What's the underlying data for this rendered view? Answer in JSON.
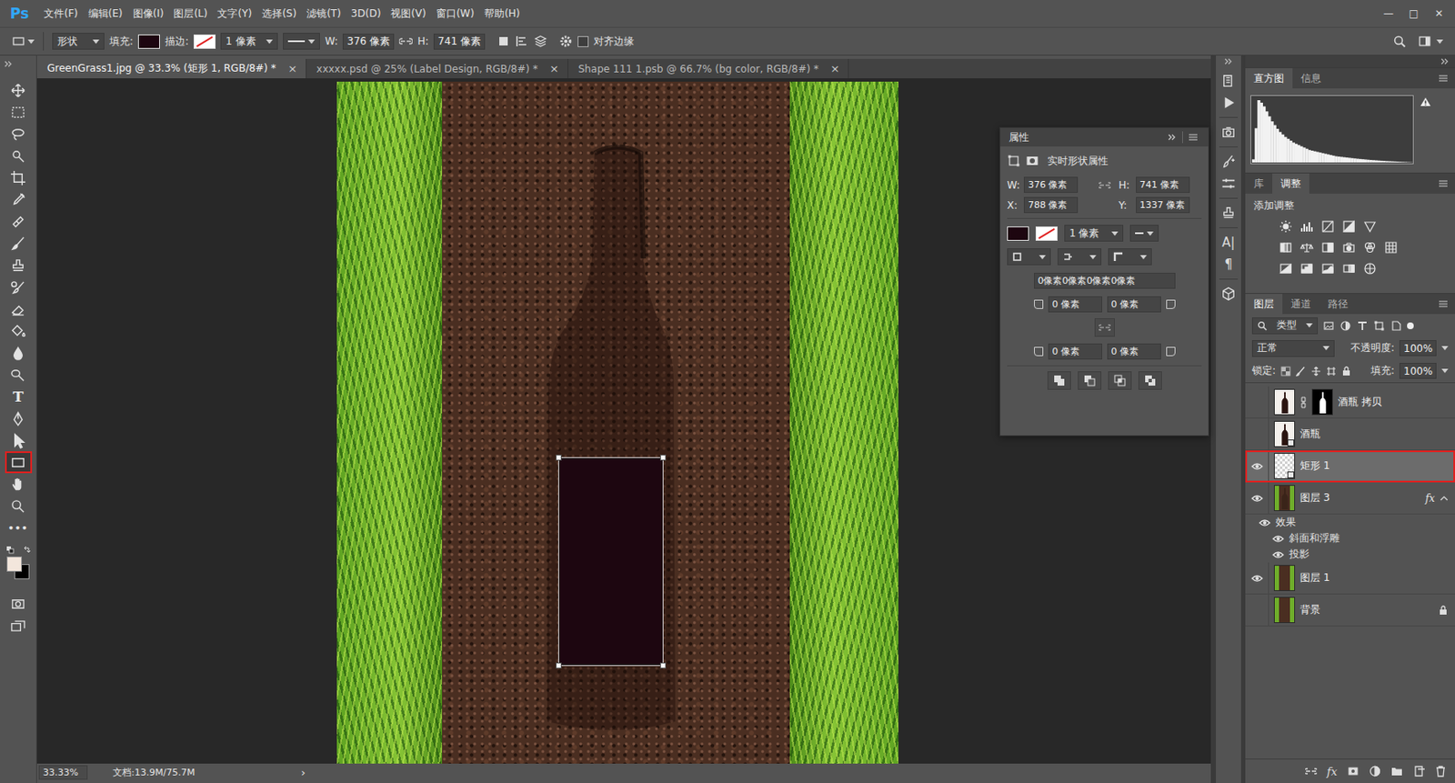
{
  "app": {
    "logo": "Ps",
    "window_controls": [
      "—",
      "□",
      "✕"
    ]
  },
  "menu": [
    "文件(F)",
    "编辑(E)",
    "图像(I)",
    "图层(L)",
    "文字(Y)",
    "选择(S)",
    "滤镜(T)",
    "3D(D)",
    "视图(V)",
    "窗口(W)",
    "帮助(H)"
  ],
  "options_bar": {
    "mode": "形状",
    "fill_label": "填充:",
    "fill_color": "#1d0610",
    "stroke_label": "描边:",
    "stroke_width": "1 像素",
    "w_label": "W:",
    "w_value": "376 像素",
    "h_label": "H:",
    "h_value": "741 像素",
    "align_edges": {
      "label": "对齐边缘",
      "checked": false
    }
  },
  "doc_tabs": [
    {
      "label": "GreenGrass1.jpg @ 33.3% (矩形 1, RGB/8#) *",
      "close": "×",
      "selected": true
    },
    {
      "label": "xxxxx.psd @ 25% (Label Design, RGB/8#) *",
      "close": "×",
      "selected": false
    },
    {
      "label": "Shape 111 1.psb @ 66.7% (bg color, RGB/8#) *",
      "close": "×",
      "selected": false
    }
  ],
  "tools": [
    {
      "kind": "move",
      "selected": false,
      "highlighted": false
    },
    {
      "kind": "marquee",
      "selected": false,
      "highlighted": false
    },
    {
      "kind": "lasso",
      "selected": false,
      "highlighted": false
    },
    {
      "kind": "quick-select",
      "selected": false,
      "highlighted": false
    },
    {
      "kind": "crop",
      "selected": false,
      "highlighted": false
    },
    {
      "kind": "eyedropper",
      "selected": false,
      "highlighted": false
    },
    {
      "kind": "healing",
      "selected": false,
      "highlighted": false
    },
    {
      "kind": "brush",
      "selected": false,
      "highlighted": false
    },
    {
      "kind": "stamp",
      "selected": false,
      "highlighted": false
    },
    {
      "kind": "history-brush",
      "selected": false,
      "highlighted": false
    },
    {
      "kind": "eraser",
      "selected": false,
      "highlighted": false
    },
    {
      "kind": "bucket",
      "selected": false,
      "highlighted": false
    },
    {
      "kind": "blur",
      "selected": false,
      "highlighted": false
    },
    {
      "kind": "dodge",
      "selected": false,
      "highlighted": false
    },
    {
      "kind": "type",
      "glyph": "T",
      "selected": false,
      "highlighted": false
    },
    {
      "kind": "pen",
      "selected": false,
      "highlighted": false
    },
    {
      "kind": "path-select",
      "selected": false,
      "highlighted": false
    },
    {
      "kind": "rectangle",
      "selected": true,
      "highlighted": true
    },
    {
      "kind": "hand",
      "selected": false,
      "highlighted": false
    },
    {
      "kind": "zoom",
      "selected": false,
      "highlighted": false
    },
    {
      "kind": "more",
      "glyph": "•••",
      "selected": false,
      "highlighted": false
    }
  ],
  "colors": {
    "foreground": "#f3e6dc",
    "background": "#000000"
  },
  "view_modes": [
    {
      "kind": "quick-mask"
    },
    {
      "kind": "screen-mode"
    }
  ],
  "canvas": {
    "shape": {
      "fill": "#1d0610",
      "selected": true
    }
  },
  "status_bar": {
    "zoom": "33.33%",
    "doc": "文档:13.9M/75.7M",
    "arrow": "›"
  },
  "dock": [
    {
      "kind": "history",
      "separator_before": false
    },
    {
      "kind": "actions",
      "separator_before": false
    },
    {
      "kind": "info",
      "separator_before": true
    },
    {
      "kind": "brush",
      "separator_before": true
    },
    {
      "kind": "sliders",
      "separator_before": false
    },
    {
      "kind": "clone-source",
      "separator_before": true
    },
    {
      "kind": "character",
      "glyph": "A|",
      "separator_before": true
    },
    {
      "kind": "paragraph",
      "glyph": "¶",
      "separator_before": false
    },
    {
      "kind": "3d",
      "separator_before": true
    }
  ],
  "properties": {
    "title": "属性",
    "subtitle": "实时形状属性",
    "fields": [
      {
        "label": "W:",
        "value": "376 像素"
      },
      {
        "label": "H:",
        "value": "741 像素"
      },
      {
        "label": "X:",
        "value": "788 像素"
      },
      {
        "label": "Y:",
        "value": "1337 像素"
      }
    ],
    "fill_color": "#1d0610",
    "stroke_width": "1 像素",
    "corners_all": "0像素0像素0像素0像素",
    "corners": [
      {
        "value": "0 像素"
      },
      {
        "value": "0 像素"
      },
      {
        "value": "0 像素"
      },
      {
        "value": "0 像素"
      }
    ],
    "path_ops": [
      {
        "kind": "combine"
      },
      {
        "kind": "subtract"
      },
      {
        "kind": "intersect"
      },
      {
        "kind": "exclude"
      }
    ]
  },
  "histogram_panel": {
    "tabs": [
      {
        "label": "直方图",
        "selected": true
      },
      {
        "label": "信息",
        "selected": false
      }
    ],
    "warning": true,
    "values": [
      0.05,
      0.55,
      1.0,
      0.96,
      0.9,
      0.82,
      0.74,
      0.66,
      0.6,
      0.54,
      0.49,
      0.45,
      0.41,
      0.38,
      0.35,
      0.32,
      0.3,
      0.28,
      0.26,
      0.24,
      0.22,
      0.2,
      0.19,
      0.18,
      0.17,
      0.16,
      0.15,
      0.14,
      0.13,
      0.12,
      0.11,
      0.1,
      0.095,
      0.09,
      0.085,
      0.08,
      0.075,
      0.07,
      0.065,
      0.06,
      0.056,
      0.052,
      0.048,
      0.044,
      0.04,
      0.037,
      0.034,
      0.031,
      0.028,
      0.025,
      0.022,
      0.02,
      0.018,
      0.016,
      0.014,
      0.012,
      0.01,
      0.008,
      0.006,
      0.004
    ]
  },
  "adjustments_panel": {
    "tabs": [
      {
        "label": "库",
        "selected": false
      },
      {
        "label": "调整",
        "selected": true
      }
    ],
    "heading": "添加调整",
    "rows": [
      [
        {
          "kind": "brightness"
        },
        {
          "kind": "levels"
        },
        {
          "kind": "curves"
        },
        {
          "kind": "exposure"
        },
        {
          "kind": "vibrance"
        }
      ],
      [
        {
          "kind": "hue-saturation"
        },
        {
          "kind": "color-balance"
        },
        {
          "kind": "black-white"
        },
        {
          "kind": "photo-filter"
        },
        {
          "kind": "channel-mixer"
        },
        {
          "kind": "color-lookup"
        }
      ],
      [
        {
          "kind": "invert"
        },
        {
          "kind": "posterize"
        },
        {
          "kind": "threshold"
        },
        {
          "kind": "gradient-map"
        },
        {
          "kind": "selective-color"
        }
      ]
    ]
  },
  "layers_panel": {
    "tabs": [
      {
        "label": "图层",
        "selected": true
      },
      {
        "label": "通道",
        "selected": false
      },
      {
        "label": "路径",
        "selected": false
      }
    ],
    "filter": "类型",
    "blend": "正常",
    "opacity_label": "不透明度:",
    "opacity": "100%",
    "lock_label": "锁定:",
    "fill_label": "填充:",
    "fill": "100%",
    "layers": [
      {
        "name": "酒瓶 拷贝",
        "thumb": "bottle",
        "mask": true,
        "badge": false,
        "visible": false,
        "selected": false,
        "highlighted": false,
        "locked": false
      },
      {
        "name": "酒瓶",
        "thumb": "bottle",
        "mask": false,
        "badge": true,
        "visible": false,
        "selected": false,
        "highlighted": false,
        "locked": false
      },
      {
        "name": "矩形 1",
        "thumb": "shape",
        "mask": false,
        "badge": true,
        "visible": true,
        "selected": true,
        "highlighted": true,
        "locked": false
      },
      {
        "name": "图层 3",
        "thumb": "grass-bottle",
        "mask": false,
        "badge": false,
        "visible": true,
        "selected": false,
        "highlighted": false,
        "locked": false,
        "fx": "fx",
        "expanded": true,
        "effects": {
          "label": "效果",
          "visible": true,
          "items": [
            {
              "label": "斜面和浮雕",
              "visible": true
            },
            {
              "label": "投影",
              "visible": true
            }
          ]
        }
      },
      {
        "name": "图层 1",
        "thumb": "grass",
        "mask": false,
        "badge": false,
        "visible": true,
        "selected": false,
        "highlighted": false,
        "locked": false
      },
      {
        "name": "背景",
        "thumb": "grass",
        "mask": false,
        "badge": false,
        "visible": false,
        "selected": false,
        "highlighted": false,
        "locked": true
      }
    ],
    "bottom": [
      {
        "kind": "link"
      },
      {
        "kind": "fx",
        "glyph": "fx"
      },
      {
        "kind": "mask"
      },
      {
        "kind": "adjustment"
      },
      {
        "kind": "group"
      },
      {
        "kind": "new"
      },
      {
        "kind": "delete"
      }
    ]
  }
}
